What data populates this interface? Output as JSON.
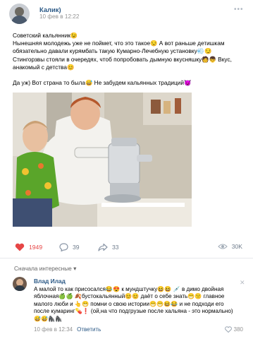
{
  "post": {
    "author": "Калик)",
    "date": "10 фев в 12:22",
    "more": "•••",
    "text_lines": [
      "Советский кальянник😉",
      "Нынешняя молодежь уже не поймет, что это такое😒 А вот раньше детишкам",
      "обязательно давали курямбать такую Кумарно-Лечебную установку💨😏",
      "Стингорзвы стояли в очередях, чтоб попробовать дымную вкусняшку🧑👦 Вкус,",
      "анакомый с детства😊",
      "Да уж) Вот страна то была😅 Не забудем кальянных традиций😈"
    ],
    "likes": "1949",
    "comments": "39",
    "shares": "33",
    "views": "30K"
  },
  "comments_header": "Сначала интересные",
  "comments_header_caret": "▾",
  "comment": {
    "author": "Влад Илад",
    "lines": [
      "А малой то как присосался😂😍 к мундштучку😆😆 💉 в димо двойная",
      "яблочная🍏🍏 🍂бустокальянный😊😊 даёт о себе знать😁😕 главное",
      "малого люби и 👆😁 помни о свою истории😁😁😆😂 и не подходи его",
      "после кумаринг💊❗ (ой,на что подгрузые после хальяна - это нормально)",
      "😅😅🦍🦍"
    ],
    "date": "10 фев в 12:34",
    "reply": "Ответить",
    "likes": "380",
    "close": "✕"
  },
  "icons": {
    "like": "heart-icon",
    "comment": "comment-bubble-icon",
    "share": "share-arrow-icon",
    "views": "eye-icon"
  },
  "colors": {
    "link": "#2a5885",
    "like": "#e64646",
    "muted": "#939393",
    "action": "#6f7c8c"
  }
}
